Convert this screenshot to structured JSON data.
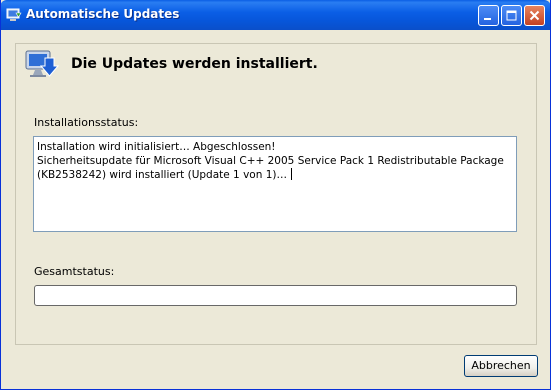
{
  "window": {
    "title": "Automatische Updates"
  },
  "header": {
    "title": "Die Updates werden installiert."
  },
  "install_status": {
    "label": "Installationsstatus:",
    "lines": [
      "Installation wird initialisiert… Abgeschlossen!",
      "Sicherheitsupdate für Microsoft Visual C++ 2005 Service Pack 1 Redistributable Package",
      "(KB2538242) wird installiert (Update 1 von 1)…"
    ]
  },
  "total_status": {
    "label": "Gesamtstatus:",
    "progress": 0
  },
  "buttons": {
    "cancel": "Abbrechen"
  },
  "colors": {
    "titlebar": "#0b5fe6",
    "dialog_bg": "#ece9d8",
    "field_border": "#7f9db9"
  },
  "icons": {
    "title": "windows-update-icon",
    "header": "computer-update-icon"
  }
}
